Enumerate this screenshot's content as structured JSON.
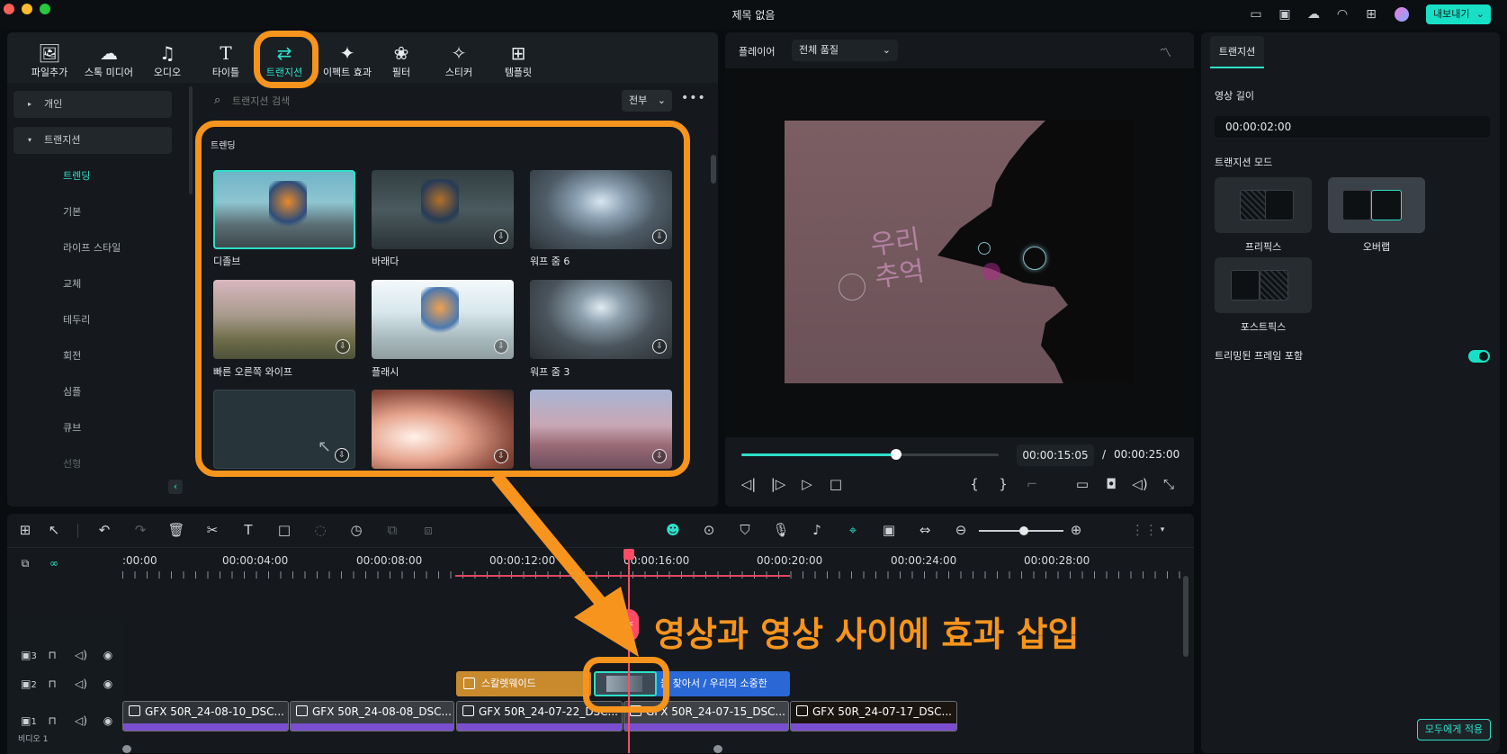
{
  "window": {
    "title": "제목 없음",
    "export_label": "내보내기"
  },
  "toolbar": {
    "items": [
      {
        "label": "파일추가",
        "icon": "import-media-icon"
      },
      {
        "label": "스톡 미디어",
        "icon": "stock-media-icon"
      },
      {
        "label": "오디오",
        "icon": "audio-icon"
      },
      {
        "label": "타이틀",
        "icon": "titles-icon"
      },
      {
        "label": "트랜지션",
        "icon": "transition-icon",
        "active": true
      },
      {
        "label": "이펙트 효과",
        "icon": "effects-icon"
      },
      {
        "label": "필터",
        "icon": "filters-icon"
      },
      {
        "label": "스티커",
        "icon": "stickers-icon"
      },
      {
        "label": "템플릿",
        "icon": "templates-icon"
      }
    ]
  },
  "sidebar": {
    "personal": "개인",
    "transition": "트랜지션",
    "items": [
      "트렌딩",
      "기본",
      "라이프 스타일",
      "교체",
      "테두리",
      "회전",
      "심플",
      "큐브",
      "선형"
    ]
  },
  "library": {
    "search_placeholder": "트랜지션 검색",
    "filter": "전부",
    "section": "트렌딩",
    "items": [
      {
        "label": "디졸브"
      },
      {
        "label": "바래다"
      },
      {
        "label": "워프 줌 6"
      },
      {
        "label": "빠른 오른쪽 와이프"
      },
      {
        "label": "플래시"
      },
      {
        "label": "워프 줌 3"
      },
      {
        "label": ""
      },
      {
        "label": ""
      },
      {
        "label": ""
      }
    ]
  },
  "player": {
    "label": "플레이어",
    "quality": "전체 품질",
    "current": "00:00:15:05",
    "separator": "/",
    "total": "00:00:25:00",
    "progress": 0.6,
    "overlay_text": "우리\n추억"
  },
  "props": {
    "tab": "트랜지션",
    "duration_label": "영상 길이",
    "duration": "00:00:02:00",
    "mode_label": "트랜지션 모드",
    "modes": [
      "프리픽스",
      "오버랩",
      "포스트픽스"
    ],
    "selected_mode": "오버랩",
    "trim_label": "트리밍된 프레임 포함",
    "trim_on": true,
    "apply_all": "모두에게 적용"
  },
  "timeline": {
    "ruler": [
      ":00:00",
      "00:00:04:00",
      "00:00:08:00",
      "00:00:12:00",
      "00:00:16:00",
      "00:00:20:00",
      "00:00:24:00",
      "00:00:28:00"
    ],
    "tracks": [
      "3",
      "2",
      "1"
    ],
    "video_label": "비디오 1",
    "track2_clips": [
      "스칼렛웨이드",
      "을 찾아서 / 우리의 소중한"
    ],
    "video_clips": [
      "GFX 50R_24-08-10_DSC...",
      "GFX 50R_24-08-08_DSC...",
      "GFX 50R_24-07-22_DSC...",
      "GFX 50R_24-07-15_DSC...",
      "GFX 50R_24-07-17_DSC..."
    ]
  },
  "annotation": {
    "text": "영상과 영상 사이에 효과 삽입"
  },
  "colors": {
    "accent": "#18e0c6",
    "annotation": "#f7941d",
    "clip_bar": "#7a4fcf"
  }
}
